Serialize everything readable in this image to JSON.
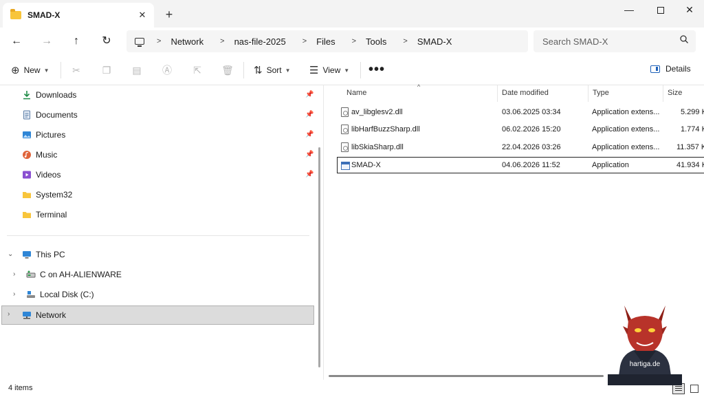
{
  "window": {
    "tab_title": "SMAD-X",
    "tab_close": "✕",
    "new_tab": "+",
    "minimize": "—",
    "close": "✕"
  },
  "navigation": {
    "back": "←",
    "forward": "→",
    "up": "↑",
    "refresh": "↻"
  },
  "breadcrumb": {
    "separator": ">",
    "items": [
      "Network",
      "nas-file-2025",
      "Files",
      "Tools",
      "SMAD-X"
    ]
  },
  "search": {
    "placeholder": "Search SMAD-X"
  },
  "toolbar": {
    "new_label": "New",
    "sort_label": "Sort",
    "view_label": "View",
    "more_label": "•••",
    "details_label": "Details",
    "icons": [
      "cut-icon",
      "copy-icon",
      "paste-icon",
      "rename-icon",
      "share-icon",
      "delete-icon"
    ]
  },
  "sidebar": {
    "quick_access": [
      {
        "label": "Downloads",
        "icon": "download-icon",
        "color": "#1e8a46"
      },
      {
        "label": "Documents",
        "icon": "document-icon",
        "color": "#5d7fa8"
      },
      {
        "label": "Pictures",
        "icon": "picture-icon",
        "color": "#2f86d6"
      },
      {
        "label": "Music",
        "icon": "music-icon",
        "color": "#e0643a"
      },
      {
        "label": "Videos",
        "icon": "video-icon",
        "color": "#8a4fd1"
      },
      {
        "label": "System32",
        "icon": "folder-icon",
        "color": "#f8c53b"
      },
      {
        "label": "Terminal",
        "icon": "folder-icon",
        "color": "#f8c53b"
      }
    ],
    "this_pc": "This PC",
    "drives": [
      {
        "label": "C on AH-ALIENWARE",
        "icon": "network-drive-icon"
      },
      {
        "label": "Local Disk (C:)",
        "icon": "local-disk-icon"
      }
    ],
    "network": "Network"
  },
  "file_list": {
    "columns": [
      "Name",
      "Date modified",
      "Type",
      "Size"
    ],
    "files": [
      {
        "name": "av_libglesv2.dll",
        "date": "03.06.2025 03:34",
        "type": "Application extens...",
        "size": "5.299 K"
      },
      {
        "name": "libHarfBuzzSharp.dll",
        "date": "06.02.2026 15:20",
        "type": "Application extens...",
        "size": "1.774 K"
      },
      {
        "name": "libSkiaSharp.dll",
        "date": "22.04.2026 03:26",
        "type": "Application extens...",
        "size": "11.357 K"
      },
      {
        "name": "SMAD-X",
        "date": "04.06.2026 11:52",
        "type": "Application",
        "size": "41.934 K"
      }
    ]
  },
  "status": {
    "item_count": "4 items"
  },
  "watermark": {
    "text": "hartiga.de"
  }
}
